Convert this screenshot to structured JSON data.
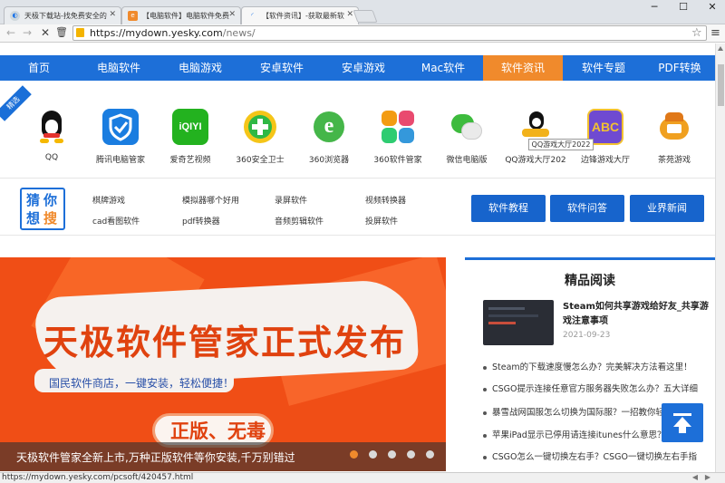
{
  "browser": {
    "tabs": [
      {
        "title": "天极下载站-找免费安全的",
        "icon": "chrome-icon"
      },
      {
        "title": "【电脑软件】电脑软件免费",
        "icon": "e-icon"
      },
      {
        "title": "【软件资讯】-获取最新软",
        "icon": "loading-icon"
      }
    ],
    "url_domain": "https://mydown.yesky.com",
    "url_path": "/news/",
    "status_url": "https://mydown.yesky.com/pcsoft/420457.html"
  },
  "nav": {
    "items": [
      "首页",
      "电脑软件",
      "电脑游戏",
      "安卓软件",
      "安卓游戏",
      "Mac软件",
      "软件资讯",
      "软件专题",
      "PDF转换"
    ],
    "active_index": 6
  },
  "featured": {
    "badge": "精选",
    "apps": [
      {
        "label": "QQ",
        "icon": "qq-penguin-icon",
        "color": "#111111"
      },
      {
        "label": "腾讯电脑管家",
        "icon": "tencent-pc-manager-icon",
        "color": "#1a7de0"
      },
      {
        "label": "爱奇艺视频",
        "icon": "iqiyi-icon",
        "color": "#23b21f"
      },
      {
        "label": "360安全卫士",
        "icon": "360-security-icon",
        "color": "#2fb844"
      },
      {
        "label": "360浏览器",
        "icon": "360-browser-icon",
        "color": "#45b649"
      },
      {
        "label": "360软件管家",
        "icon": "360-software-manager-icon",
        "color": "#e94a6f"
      },
      {
        "label": "微信电脑版",
        "icon": "wechat-icon",
        "color": "#3dbb3d"
      },
      {
        "label": "QQ游戏大厅202",
        "icon": "qq-game-icon",
        "color": "#f2b21b"
      },
      {
        "label": "边锋游戏大厅",
        "icon": "bianfeng-game-icon",
        "color": "#6f4ad1"
      },
      {
        "label": "茶苑游戏",
        "icon": "chayuan-game-icon",
        "color": "#f0a020"
      }
    ],
    "tooltip": "QQ游戏大厅2022"
  },
  "search_hot": {
    "logo_chars": [
      "猜",
      "你",
      "想",
      "搜"
    ],
    "keywords": [
      "棋牌游戏",
      "模拟器哪个好用",
      "录屏软件",
      "视频转换器",
      "cad看图软件",
      "pdf转换器",
      "音频剪辑软件",
      "投屏软件"
    ],
    "buttons": [
      "软件教程",
      "软件问答",
      "业界新闻"
    ]
  },
  "banner": {
    "headline": "天极软件管家正式发布",
    "subline": "国民软件商店，一键安装，轻松便捷！",
    "pill": "正版、无毒",
    "caption": "天极软件管家全新上市,万种正版软件等你安装,千万别错过",
    "active_slide": 0,
    "slide_count": 5
  },
  "reading": {
    "title": "精品阅读",
    "featured_title": "Steam如何共享游戏给好友_共享游戏注意事项",
    "featured_date": "2021-09-23",
    "items": [
      "Steam的下载速度慢怎么办？完美解决方法看这里！",
      "CSGO提示连接任意官方服务器失败怎么办？五大详细",
      "暴雪战网国服怎么切换为国际服？一招教你轻松",
      "苹果iPad显示已停用请连接itunes什么意思？三",
      "CSGO怎么一键切换左右手？CSGO一键切换左右手指"
    ]
  }
}
